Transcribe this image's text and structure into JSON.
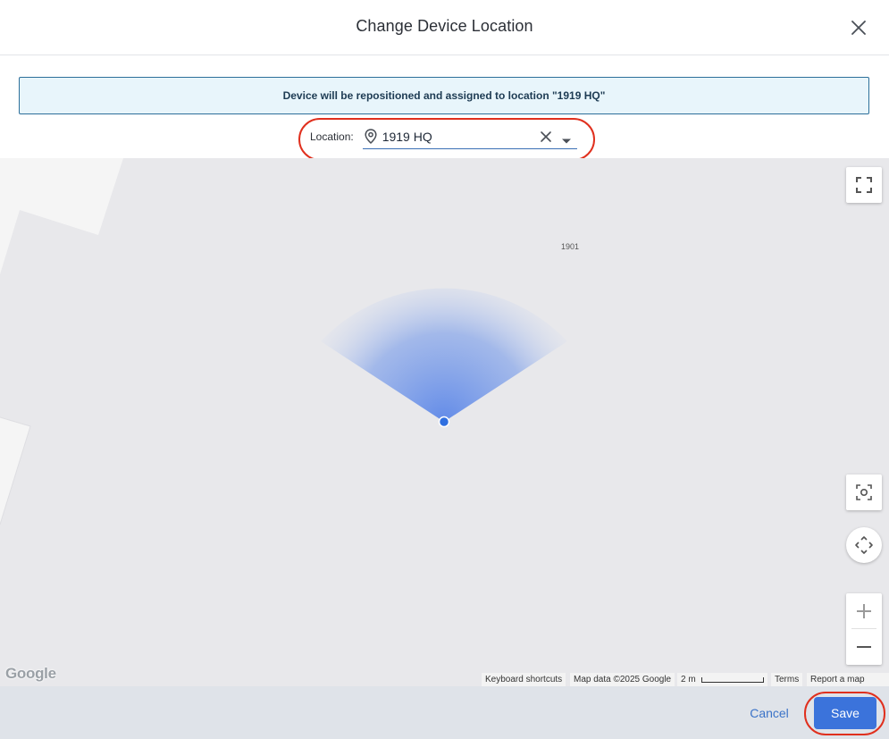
{
  "header": {
    "title": "Change Device Location"
  },
  "banner": {
    "message": "Device will be repositioned and assigned to location \"1919 HQ\""
  },
  "location": {
    "label": "Location:",
    "value": "1919 HQ"
  },
  "map": {
    "building_label": "1901",
    "logo": "Google",
    "attribution": {
      "keyboard": "Keyboard shortcuts",
      "map_data": "Map data ©2025 Google",
      "scale": "2 m",
      "terms": "Terms",
      "report": "Report a map error"
    },
    "colors": {
      "device_dot": "#2f6fe0",
      "fov_cone": "#5b86e8",
      "building": "#f5f5f5",
      "ground": "#e8e8eb"
    }
  },
  "footer": {
    "cancel_label": "Cancel",
    "save_label": "Save"
  },
  "icons": {
    "close": "close-icon",
    "pin": "map-pin-icon",
    "clear": "clear-icon",
    "dropdown": "caret-down-icon",
    "fullscreen": "fullscreen-icon",
    "focus": "focus-icon",
    "pan": "pan-icon",
    "zoom_in": "plus-icon",
    "zoom_out": "minus-icon"
  }
}
